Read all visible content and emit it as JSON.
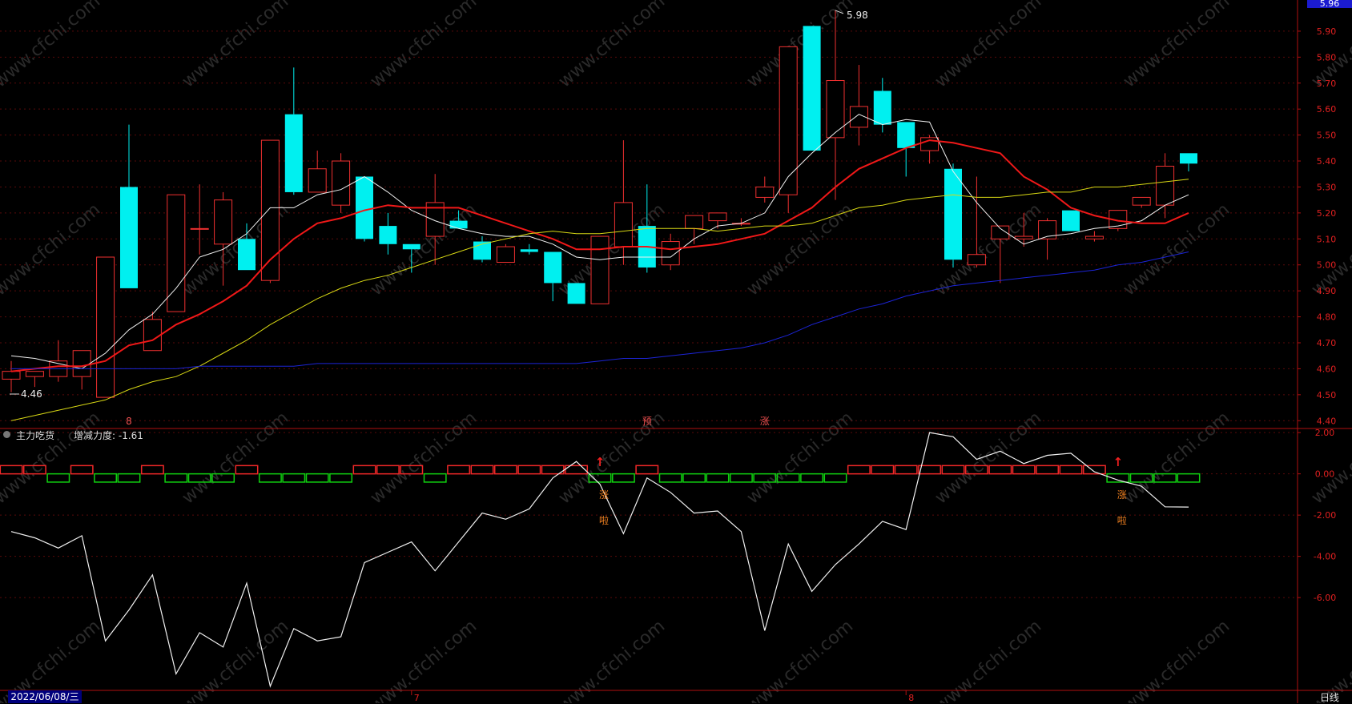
{
  "chart_data": {
    "type": "candlestick",
    "price_axis": {
      "ticks": [
        "5.90",
        "5.80",
        "5.70",
        "5.60",
        "5.50",
        "5.40",
        "5.30",
        "5.20",
        "5.10",
        "5.00",
        "4.90",
        "4.80",
        "4.70",
        "4.60",
        "4.50",
        "4.40"
      ],
      "ylim": [
        4.37,
        6.02
      ],
      "current_price_badge": "5.96"
    },
    "annotations": {
      "high_label": "5.98",
      "low_label": "4.46"
    },
    "candles": [
      {
        "o": 4.56,
        "h": 4.63,
        "l": 4.51,
        "c": 4.59
      },
      {
        "o": 4.57,
        "h": 4.59,
        "l": 4.53,
        "c": 4.59
      },
      {
        "o": 4.57,
        "h": 4.71,
        "l": 4.55,
        "c": 4.63
      },
      {
        "o": 4.57,
        "h": 4.67,
        "l": 4.52,
        "c": 4.67
      },
      {
        "o": 4.49,
        "h": 5.03,
        "l": 4.49,
        "c": 5.03
      },
      {
        "o": 5.3,
        "h": 5.54,
        "l": 4.91,
        "c": 4.91
      },
      {
        "o": 4.67,
        "h": 4.82,
        "l": 4.67,
        "c": 4.79
      },
      {
        "o": 4.82,
        "h": 5.27,
        "l": 4.82,
        "c": 5.27
      },
      {
        "o": 5.14,
        "h": 5.31,
        "l": 5.04,
        "c": 5.14
      },
      {
        "o": 5.08,
        "h": 5.28,
        "l": 4.92,
        "c": 5.25
      },
      {
        "o": 5.1,
        "h": 5.16,
        "l": 4.98,
        "c": 4.98
      },
      {
        "o": 4.94,
        "h": 5.48,
        "l": 4.93,
        "c": 5.48
      },
      {
        "o": 5.58,
        "h": 5.76,
        "l": 5.27,
        "c": 5.28
      },
      {
        "o": 5.28,
        "h": 5.44,
        "l": 5.28,
        "c": 5.37
      },
      {
        "o": 5.23,
        "h": 5.43,
        "l": 5.2,
        "c": 5.4
      },
      {
        "o": 5.34,
        "h": 5.34,
        "l": 5.09,
        "c": 5.1
      },
      {
        "o": 5.15,
        "h": 5.2,
        "l": 5.04,
        "c": 5.08
      },
      {
        "o": 5.08,
        "h": 5.08,
        "l": 4.97,
        "c": 5.06
      },
      {
        "o": 5.11,
        "h": 5.35,
        "l": 5.0,
        "c": 5.24
      },
      {
        "o": 5.17,
        "h": 5.21,
        "l": 5.14,
        "c": 5.14
      },
      {
        "o": 5.09,
        "h": 5.11,
        "l": 5.01,
        "c": 5.02
      },
      {
        "o": 5.01,
        "h": 5.08,
        "l": 5.01,
        "c": 5.07
      },
      {
        "o": 5.06,
        "h": 5.08,
        "l": 5.04,
        "c": 5.05
      },
      {
        "o": 5.05,
        "h": 5.05,
        "l": 4.86,
        "c": 4.93
      },
      {
        "o": 4.93,
        "h": 4.93,
        "l": 4.85,
        "c": 4.85
      },
      {
        "o": 4.85,
        "h": 5.11,
        "l": 4.85,
        "c": 5.11
      },
      {
        "o": 5.07,
        "h": 5.48,
        "l": 5.0,
        "c": 5.24
      },
      {
        "o": 5.15,
        "h": 5.31,
        "l": 4.97,
        "c": 4.99
      },
      {
        "o": 5.0,
        "h": 5.12,
        "l": 4.98,
        "c": 5.09
      },
      {
        "o": 5.14,
        "h": 5.19,
        "l": 5.08,
        "c": 5.19
      },
      {
        "o": 5.17,
        "h": 5.2,
        "l": 5.14,
        "c": 5.2
      },
      {
        "o": 5.16,
        "h": 5.18,
        "l": 5.15,
        "c": 5.16
      },
      {
        "o": 5.26,
        "h": 5.34,
        "l": 5.24,
        "c": 5.3
      },
      {
        "o": 5.27,
        "h": 5.84,
        "l": 5.2,
        "c": 5.84
      },
      {
        "o": 5.92,
        "h": 5.92,
        "l": 5.44,
        "c": 5.44
      },
      {
        "o": 5.49,
        "h": 5.98,
        "l": 5.25,
        "c": 5.71
      },
      {
        "o": 5.53,
        "h": 5.77,
        "l": 5.46,
        "c": 5.61
      },
      {
        "o": 5.67,
        "h": 5.72,
        "l": 5.51,
        "c": 5.54
      },
      {
        "o": 5.55,
        "h": 5.55,
        "l": 5.34,
        "c": 5.45
      },
      {
        "o": 5.44,
        "h": 5.5,
        "l": 5.39,
        "c": 5.49
      },
      {
        "o": 5.37,
        "h": 5.39,
        "l": 4.99,
        "c": 5.02
      },
      {
        "o": 5.0,
        "h": 5.34,
        "l": 4.99,
        "c": 5.04
      },
      {
        "o": 5.1,
        "h": 5.15,
        "l": 4.93,
        "c": 5.15
      },
      {
        "o": 5.1,
        "h": 5.2,
        "l": 5.07,
        "c": 5.11
      },
      {
        "o": 5.1,
        "h": 5.18,
        "l": 5.02,
        "c": 5.17
      },
      {
        "o": 5.21,
        "h": 5.21,
        "l": 5.13,
        "c": 5.13
      },
      {
        "o": 5.1,
        "h": 5.13,
        "l": 5.09,
        "c": 5.11
      },
      {
        "o": 5.14,
        "h": 5.21,
        "l": 5.13,
        "c": 5.21
      },
      {
        "o": 5.23,
        "h": 5.26,
        "l": 5.22,
        "c": 5.26
      },
      {
        "o": 5.23,
        "h": 5.43,
        "l": 5.18,
        "c": 5.38
      },
      {
        "o": 5.43,
        "h": 5.43,
        "l": 5.36,
        "c": 5.39
      }
    ],
    "ma_lines": [
      {
        "color": "#f0f0f0",
        "values": [
          4.65,
          4.64,
          4.62,
          4.6,
          4.66,
          4.75,
          4.81,
          4.91,
          5.03,
          5.06,
          5.12,
          5.22,
          5.22,
          5.27,
          5.29,
          5.34,
          5.28,
          5.21,
          5.17,
          5.14,
          5.12,
          5.11,
          5.11,
          5.08,
          5.03,
          5.02,
          5.03,
          5.03,
          5.03,
          5.1,
          5.15,
          5.16,
          5.2,
          5.34,
          5.43,
          5.51,
          5.58,
          5.54,
          5.56,
          5.55,
          5.36,
          5.24,
          5.14,
          5.08,
          5.11,
          5.12,
          5.14,
          5.15,
          5.17,
          5.23,
          5.27
        ]
      },
      {
        "color": "#f01818",
        "values": [
          4.59,
          4.6,
          4.61,
          4.61,
          4.63,
          4.69,
          4.71,
          4.77,
          4.81,
          4.86,
          4.92,
          5.02,
          5.1,
          5.16,
          5.18,
          5.21,
          5.23,
          5.22,
          5.22,
          5.22,
          5.19,
          5.16,
          5.13,
          5.1,
          5.06,
          5.06,
          5.07,
          5.07,
          5.06,
          5.07,
          5.08,
          5.1,
          5.12,
          5.17,
          5.22,
          5.3,
          5.37,
          5.41,
          5.45,
          5.48,
          5.47,
          5.45,
          5.43,
          5.34,
          5.29,
          5.22,
          5.19,
          5.17,
          5.16,
          5.16,
          5.2
        ]
      },
      {
        "color": "#d8d814",
        "values": [
          4.4,
          4.42,
          4.44,
          4.46,
          4.48,
          4.52,
          4.55,
          4.57,
          4.61,
          4.66,
          4.71,
          4.77,
          4.82,
          4.87,
          4.91,
          4.94,
          4.96,
          4.99,
          5.02,
          5.05,
          5.08,
          5.1,
          5.12,
          5.13,
          5.12,
          5.12,
          5.13,
          5.14,
          5.14,
          5.14,
          5.13,
          5.14,
          5.15,
          5.15,
          5.16,
          5.19,
          5.22,
          5.23,
          5.25,
          5.26,
          5.27,
          5.26,
          5.26,
          5.27,
          5.28,
          5.28,
          5.3,
          5.3,
          5.31,
          5.32,
          5.33
        ]
      },
      {
        "color": "#1c24d6",
        "values": [
          4.6,
          4.6,
          4.6,
          4.6,
          4.6,
          4.6,
          4.6,
          4.6,
          4.61,
          4.61,
          4.61,
          4.61,
          4.61,
          4.62,
          4.62,
          4.62,
          4.62,
          4.62,
          4.62,
          4.62,
          4.62,
          4.62,
          4.62,
          4.62,
          4.62,
          4.63,
          4.64,
          4.64,
          4.65,
          4.66,
          4.67,
          4.68,
          4.7,
          4.73,
          4.77,
          4.8,
          4.83,
          4.85,
          4.88,
          4.9,
          4.92,
          4.93,
          4.94,
          4.95,
          4.96,
          4.97,
          4.98,
          5.0,
          5.01,
          5.03,
          5.05
        ]
      }
    ],
    "price_markers": [
      {
        "index": 5,
        "text": "8"
      },
      {
        "index": 27,
        "text": "预"
      },
      {
        "index": 32,
        "text": "涨"
      }
    ],
    "indicator": {
      "name": "主力吃货",
      "title": "增减力度: -1.61",
      "ticks": [
        "2.00",
        "0.00",
        "-2.00",
        "-4.00",
        "-6.00"
      ],
      "ylim": [
        -10.5,
        2.2
      ],
      "bars": [
        0.4,
        0.4,
        -0.4,
        0.4,
        -0.4,
        -0.4,
        0.4,
        -0.4,
        -0.4,
        -0.4,
        0.4,
        -0.4,
        -0.4,
        -0.4,
        -0.4,
        0.4,
        0.4,
        0.4,
        -0.4,
        0.4,
        0.4,
        0.4,
        0.4,
        0.4,
        0.4,
        -0.4,
        -0.4,
        0.4,
        -0.4,
        -0.4,
        -0.4,
        -0.4,
        -0.4,
        -0.4,
        -0.4,
        -0.4,
        0.4,
        0.4,
        0.4,
        0.4,
        0.4,
        0.4,
        0.4,
        0.4,
        0.4,
        0.4,
        0.4,
        -0.4,
        -0.4,
        -0.4,
        -0.4
      ],
      "line": [
        -2.8,
        -3.1,
        -3.6,
        -3.0,
        -8.1,
        -6.6,
        -4.9,
        -9.7,
        -7.7,
        -8.4,
        -5.3,
        -10.3,
        -7.5,
        -8.1,
        -7.9,
        -4.3,
        -3.8,
        -3.3,
        -4.7,
        -3.3,
        -1.9,
        -2.2,
        -1.7,
        -0.2,
        0.6,
        -0.5,
        -2.9,
        -0.2,
        -0.9,
        -1.9,
        -1.8,
        -2.8,
        -7.6,
        -3.4,
        -5.7,
        -4.4,
        -3.4,
        -2.3,
        -2.7,
        2.0,
        1.8,
        0.7,
        1.1,
        0.5,
        0.9,
        1.0,
        0.1,
        -0.3,
        -0.6,
        -1.6,
        -1.61
      ],
      "markers": [
        {
          "index": 25,
          "arrow": "↑",
          "labels": [
            "涨",
            "啦"
          ]
        },
        {
          "index": 47,
          "arrow": "↑",
          "labels": [
            "涨",
            "啦"
          ]
        }
      ]
    },
    "time_axis": {
      "start": "2022/06/08/三",
      "labels": [
        {
          "index": 17,
          "text": "7"
        },
        {
          "index": 38,
          "text": "8"
        }
      ],
      "period": "日线"
    },
    "watermark": "www.cfchi.com"
  }
}
